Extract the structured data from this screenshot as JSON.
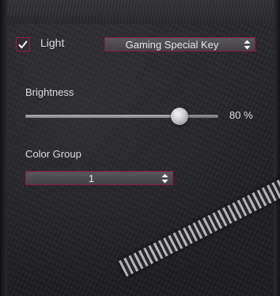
{
  "light": {
    "label": "Light",
    "checked": true
  },
  "mode_select": {
    "value": "Gaming Special Key"
  },
  "brightness": {
    "label": "Brightness",
    "value_percent": 80,
    "value_text": "80 %"
  },
  "color_group": {
    "label": "Color Group",
    "value": "1"
  },
  "colors": {
    "accent_border": "#8c1f3c",
    "checkmark": "#ffffff"
  },
  "icons": [
    "checkmark-icon",
    "spin-arrows-icon"
  ]
}
